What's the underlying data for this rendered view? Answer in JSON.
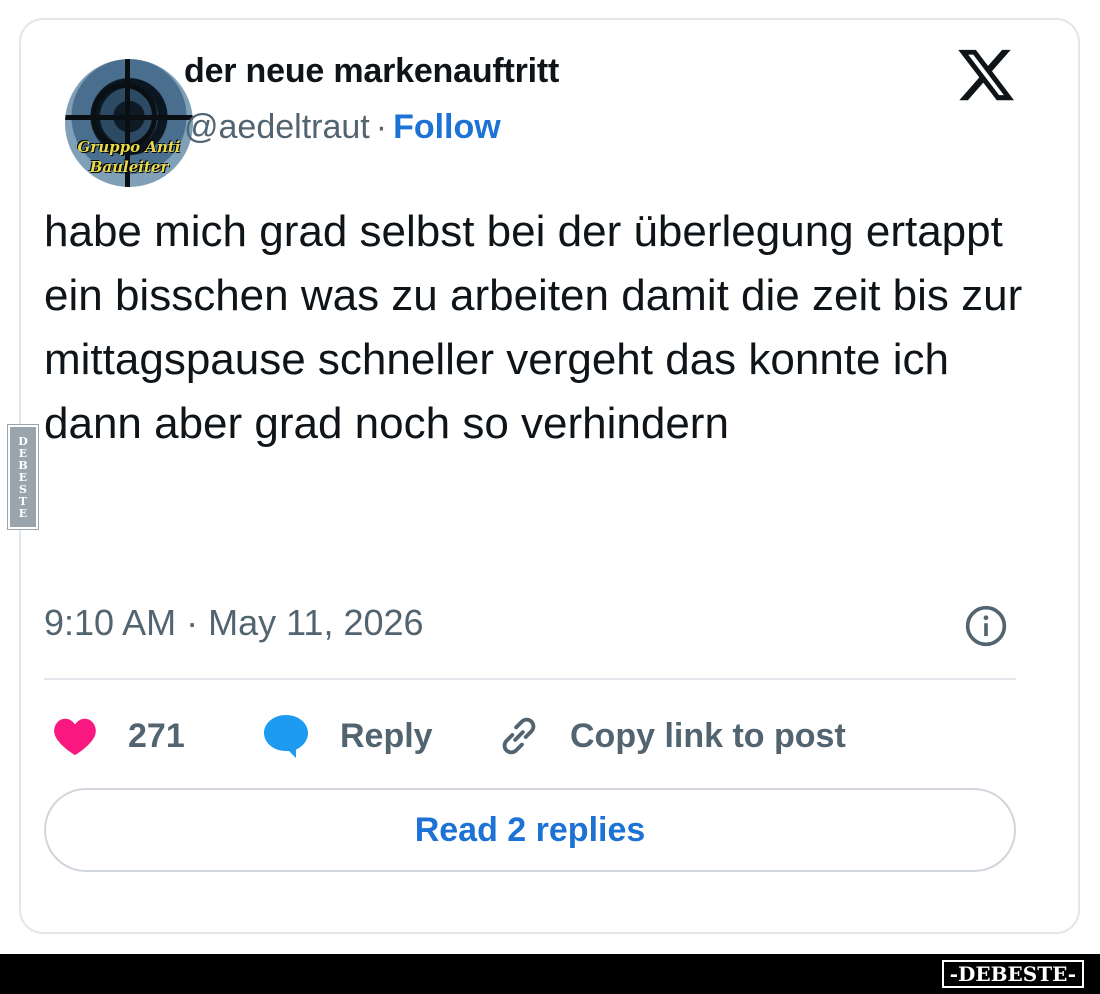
{
  "tweet": {
    "display_name": "der neue markenauftritt",
    "handle": "@aedeltraut",
    "separator": "·",
    "follow_label": "Follow",
    "avatar_text_line1": "Gruppo Anti",
    "avatar_text_line2": "Bauleiter",
    "text": "habe mich grad selbst bei der überlegung ertappt ein bisschen was zu arbeiten damit die zeit bis zur mittagspause schneller vergeht das konnte ich dann aber grad noch so verhindern",
    "timestamp": "9:10 AM · May 11, 2026",
    "like_count": "271",
    "reply_label": "Reply",
    "copy_link_label": "Copy link to post",
    "read_replies_label": "Read 2 replies"
  },
  "watermark": {
    "side_text": "DEBESTE",
    "footer_text": "-DEBESTE-"
  },
  "colors": {
    "accent": "#1d72d6",
    "like": "#f91880",
    "reply_icon": "#1d9bf0",
    "muted": "#536471"
  }
}
